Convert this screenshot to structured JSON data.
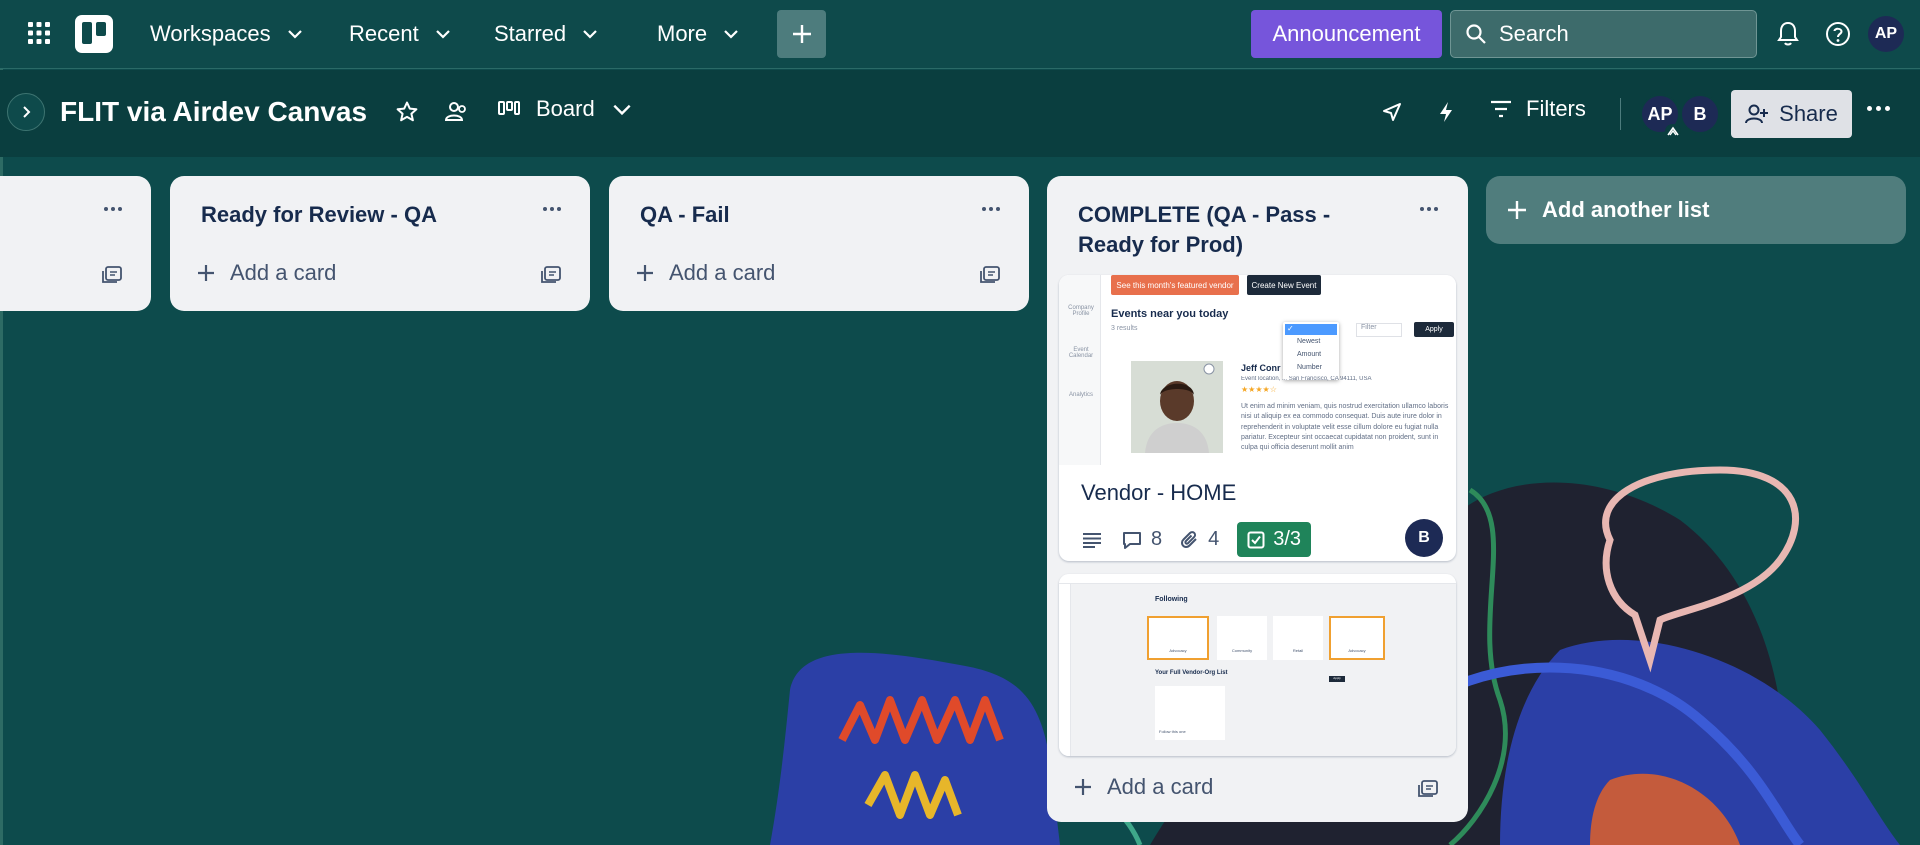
{
  "topnav": {
    "workspaces": "Workspaces",
    "recent": "Recent",
    "starred": "Starred",
    "more": "More",
    "announcement": "Announcement",
    "search_placeholder": "Search",
    "avatar": "AP"
  },
  "board": {
    "title": "FLIT via Airdev Canvas",
    "view": "Board",
    "filters": "Filters",
    "members": [
      "AP",
      "B"
    ],
    "share": "Share"
  },
  "lists": [
    {
      "title": "",
      "add_card": ""
    },
    {
      "title": "Ready for Review - QA",
      "add_card": "Add a card"
    },
    {
      "title": "QA - Fail",
      "add_card": "Add a card"
    },
    {
      "title": "COMPLETE (QA - Pass - Ready for Prod)",
      "add_card": "Add a card"
    }
  ],
  "add_list": "Add another list",
  "cards": {
    "vendor_home": {
      "title": "Vendor - HOME",
      "comments": "8",
      "attachments": "4",
      "checklist": "3/3",
      "member": "B",
      "cover": {
        "featured_btn": "See this month's featured vendor",
        "create_btn": "Create New Event",
        "heading": "Events near you today",
        "results": "3 results",
        "filter": "Filter",
        "apply": "Apply",
        "dropdown": [
          "Newest",
          "Amount",
          "Number"
        ],
        "vendor_name": "Jeff Conr",
        "vendor_location": "Event location, ... San Francisco, CA 94111, USA",
        "body": "Ut enim ad minim veniam, quis nostrud exercitation ullamco laboris nisi ut aliquip ex ea commodo consequat. Duis aute irure dolor in reprehenderit in voluptate velit esse cillum dolore eu fugiat nulla pariatur. Excepteur sint occaecat cupidatat non proident, sunt in culpa qui officia deserunt mollit anim",
        "side": [
          "Company Profile",
          "Event Calendar",
          "Analytics"
        ]
      }
    },
    "following": {
      "cover": {
        "heading": "Following",
        "tiles": [
          "Advocacy",
          "Community",
          "Retail",
          "Advocacy"
        ],
        "list_heading": "Your Full Vendor-Org List",
        "follow_text": "Follow this one",
        "apply": "Apply"
      }
    }
  },
  "colors": {
    "background": "#0d4b4c",
    "announcement": "#7655db",
    "checklist_complete": "#1f845a",
    "avatar": "#1d2a55"
  }
}
